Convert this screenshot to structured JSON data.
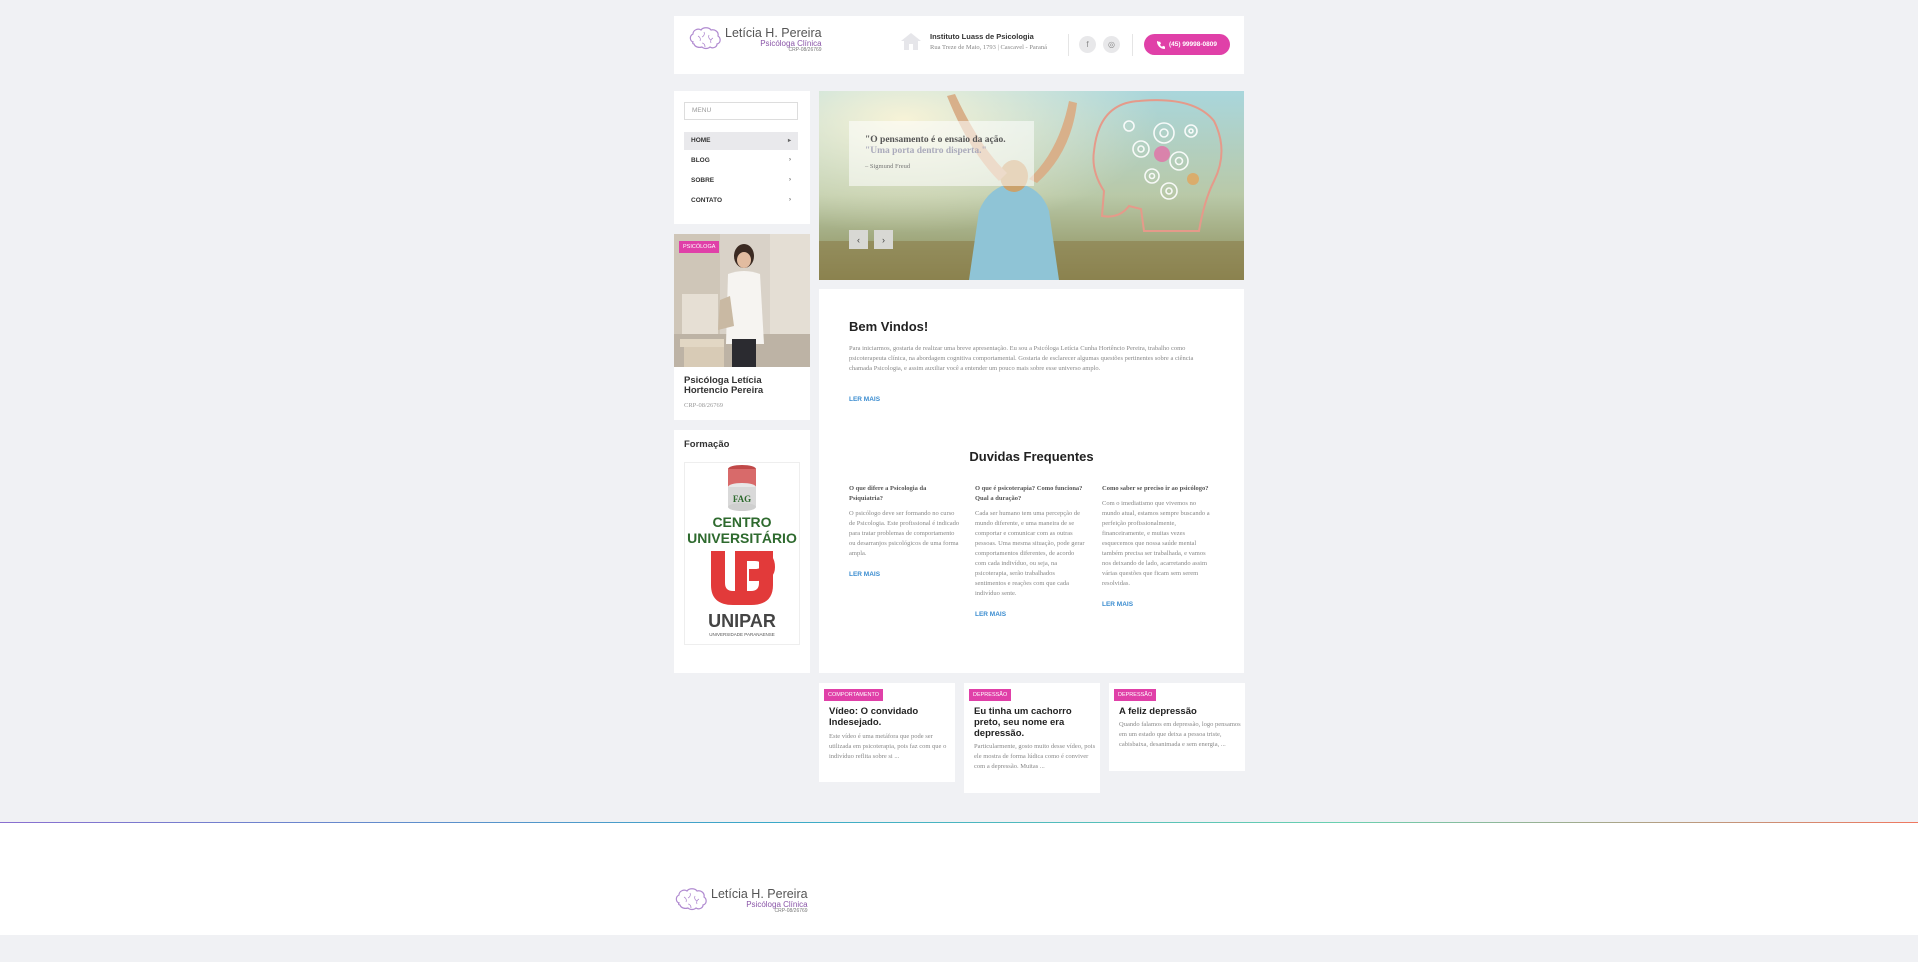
{
  "header": {
    "logo": {
      "name": "Letícia H. Pereira",
      "subtitle": "Psicóloga Clínica",
      "crp": "CRP-08/26769"
    },
    "address": {
      "title": "Instituto Luass de Psicologia",
      "line": "Rua Treze de Maio, 1793 | Cascavel - Paraná"
    },
    "social": {
      "facebook": "f",
      "instagram": "◎"
    },
    "phone": "(45) 99998-0809",
    "accent": "#e040a8"
  },
  "sidebar": {
    "menu_placeholder": "MENU",
    "menu_items": [
      {
        "label": "HOME"
      },
      {
        "label": "BLOG"
      },
      {
        "label": "SOBRE"
      },
      {
        "label": "CONTATO"
      }
    ],
    "profile": {
      "tag": "PSICÓLOGA",
      "name": "Psicóloga Letícia Hortencio Pereira",
      "crp": "CRP-08/26769"
    },
    "formacao": {
      "title": "Formação",
      "logos": [
        {
          "text": "FAG",
          "subtitle": "CENTRO UNIVERSITÁRIO"
        },
        {
          "text": "UNIPAR",
          "subtitle": "UNIVERSIDADE PARANAENSE"
        }
      ]
    }
  },
  "slider": {
    "quote_main": "\"O pensamento é o ensaio da ação.",
    "quote_faded": "\"Uma porta dentro disperta.\"",
    "author": "– Sigmund Freud",
    "prev": "‹",
    "next": "›"
  },
  "welcome": {
    "title": "Bem Vindos!",
    "text": "Para iniciarmos, gostaria de realizar uma breve apresentação. Eu sou a Psicóloga Letícia Cunha Hortêncio Pereira, trabalho como psicoterapeuta clínica, na abordagem cognitiva comportamental. Gostaria de esclarecer algumas questões pertinentes sobre a ciência chamada Psicologia, e assim auxiliar você a entender um pouco mais sobre esse universo amplo.",
    "read_more": "LER MAIS"
  },
  "faq": {
    "title": "Duvidas Frequentes",
    "items": [
      {
        "q": "O que difere a Psicologia da Psiquiatria?",
        "a": "O psicólogo deve ser formando no curso de Psicologia. Este profissional é indicado para tratar problemas de comportamento ou desarranjos psicológicos de uma forma ampla.",
        "more": "LER MAIS"
      },
      {
        "q": "O que é psicoterapia? Como funciona? Qual a duração?",
        "a": "Cada ser humano tem uma percepção de mundo diferente, e uma maneira de se comportar e comunicar com as outras pessoas. Uma mesma situação, pode gerar comportamentos diferentes, de acordo com cada indivíduo, ou seja, na psicoterapia, serão trabalhados sentimentos e reações com que cada indivíduo sente.",
        "more": "LER MAIS"
      },
      {
        "q": "Como saber se preciso ir ao psicólogo?",
        "a": "Com o imediatismo que vivemos no mundo atual, estamos sempre buscando a perfeição profissionalmente, financeiramente, e muitas vezes esquecemos que nossa saúde mental também precisa ser trabalhada, e vamos nos deixando de lado, acarretando assim várias questões que ficam sem serem resolvidas.",
        "more": "LER MAIS"
      }
    ]
  },
  "posts": [
    {
      "tag": "COMPORTAMENTO",
      "title": "Vídeo: O convidado Indesejado.",
      "excerpt": " Este vídeo é uma metáfora que pode ser utilizada em psicoterapia, pois faz com que o indivíduo reflita sobre si ..."
    },
    {
      "tag": "DEPRESSÃO",
      "title": "Eu tinha um cachorro preto, seu nome era depressão.",
      "excerpt": " Particularmente, gosto muito desse vídeo, pois ele mostra de forma lúdica como é conviver com a depressão. Muitas ..."
    },
    {
      "tag": "DEPRESSÃO",
      "title": "A feliz depressão",
      "excerpt": "Quando falamos em depressão, logo pensamos em um estado que deixa a pessoa triste, cabisbaixa, desanimada e sem energia, ..."
    }
  ],
  "footer": {
    "logo": {
      "name": "Letícia H. Pereira",
      "subtitle": "Psicóloga Clínica",
      "crp": "CRP-08/26769"
    }
  }
}
